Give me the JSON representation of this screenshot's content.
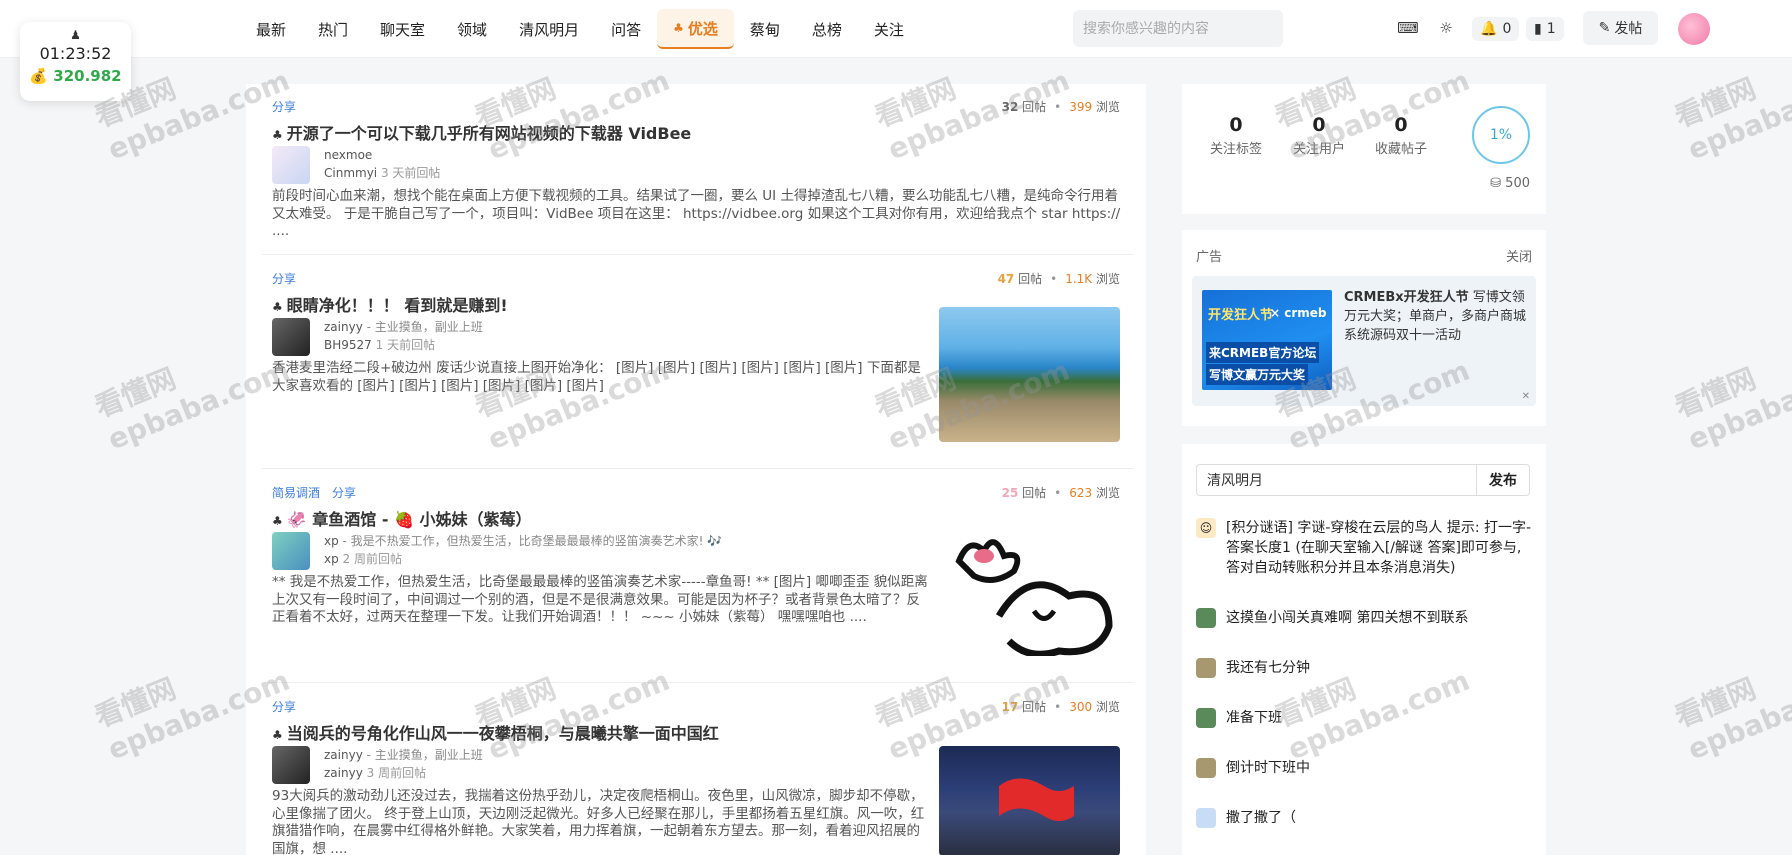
{
  "header": {
    "nav": [
      {
        "label": "最新"
      },
      {
        "label": "热门"
      },
      {
        "label": "聊天室"
      },
      {
        "label": "领域"
      },
      {
        "label": "清风明月"
      },
      {
        "label": "问答"
      },
      {
        "label": "优选",
        "active": true
      },
      {
        "label": "蔡甸"
      },
      {
        "label": "总榜"
      },
      {
        "label": "关注"
      }
    ],
    "search_placeholder": "搜索你感兴趣的内容",
    "notif_count": "0",
    "msg_count": "1",
    "post_label": "发帖"
  },
  "timer": {
    "time": "01:23:52",
    "money": "320.982"
  },
  "posts": [
    {
      "tags": [
        "分享"
      ],
      "replies": "32",
      "reply_label": "回帖",
      "views": "399",
      "view_label": "浏览",
      "reply_color": "#e67e22",
      "title": "开源了一个可以下载几乎所有网站视频的下载器 VidBee",
      "author": "nexmoe",
      "signature": "",
      "last_user": "Cinmmyi",
      "last_time": "3 天前回帖",
      "excerpt": "前段时间心血来潮，想找个能在桌面上方便下载视频的工具。结果试了一圈，要么 UI 土得掉渣乱七八糟，要么功能乱七八糟，是纯命令行用着又太难受。 于是干脆自己写了一个，项目叫：VidBee 项目在这里： https://vidbee.org 如果这个工具对你有用，欢迎给我点个 star https:// ...."
    },
    {
      "tags": [
        "分享"
      ],
      "replies": "47",
      "reply_label": "回帖",
      "views": "1.1K",
      "view_label": "浏览",
      "reply_color": "#e6a23c",
      "title": "眼睛净化！！！ 看到就是赚到!",
      "author": "zainyy",
      "signature": " - 主业摸鱼，副业上班",
      "last_user": "BH9527",
      "last_time": "1 天前回帖",
      "excerpt": "香港麦里浩经二段+破边州 废话少说直接上图开始净化： [图片] [图片] [图片] [图片] [图片] [图片] 下面都是大家喜欢看的 [图片] [图片] [图片] [图片] [图片] [图片]"
    },
    {
      "tags": [
        "简易调酒",
        "分享"
      ],
      "replies": "25",
      "reply_label": "回帖",
      "views": "623",
      "view_label": "浏览",
      "reply_color": "#f4a6b6",
      "title": "🦑 章鱼酒馆 - 🍓 小姊妹（紫莓）",
      "author": "xp",
      "signature": " - 我是不热爱工作，但热爱生活，比奇堡最最最棒的竖笛演奏艺术家! 🎶",
      "last_user": "xp",
      "last_time": "2 周前回帖",
      "excerpt": "** 我是不热爱工作，但热爱生活，比奇堡最最最棒的竖笛演奏艺术家-----章鱼哥! ** [图片] 唧唧歪歪 貌似距离上次又有一段时间了，中间调过一个别的酒，但是不是很满意效果。可能是因为杯子？或者背景色太暗了？反正看着不太好，过两天在整理一下发。让我们开始调酒！！！ ~~~ 小姊妹（紫莓） 嘿嘿嘿咱也 ...."
    },
    {
      "tags": [
        "分享"
      ],
      "replies": "17",
      "reply_label": "回帖",
      "views": "300",
      "view_label": "浏览",
      "reply_color": "#e6a23c",
      "title": "当阅兵的号角化作山风一一夜攀梧桐，与晨曦共擎一面中国红",
      "author": "zainyy",
      "signature": " - 主业摸鱼，副业上班",
      "last_user": "zainyy",
      "last_time": "3 周前回帖",
      "excerpt": "93大阅兵的激动劲儿还没过去，我揣着这份热乎劲儿，决定夜爬梧桐山。夜色里，山风微凉，脚步却不停歇，心里像揣了团火。 终于登上山顶，天边刚泛起微光。好多人已经聚在那儿，手里都扬着五星红旗。风一吹，红旗猎猎作响，在晨雾中红得格外鲜艳。大家笑着，用力挥着旗，一起朝着东方望去。那一刻，看着迎风招展的国旗，想 ...."
    }
  ],
  "profile": {
    "stats": [
      {
        "num": "0",
        "label": "关注标签"
      },
      {
        "num": "0",
        "label": "关注用户"
      },
      {
        "num": "0",
        "label": "收藏帖子"
      }
    ],
    "progress": "1%",
    "progress_value": 0.01,
    "points": "500"
  },
  "ad": {
    "label": "广告",
    "close": "关闭",
    "img_line1": "开发狂人节",
    "img_line2": "× crmeb",
    "img_line3": "来CRMEB官方论坛",
    "img_line4": "写博文赢万元大奖",
    "title": "CRMEBx开发狂人节",
    "text": " 写博文领万元大奖；单商户，多商户商城系统源码双十一活动"
  },
  "chat": {
    "input_value": "清风明月",
    "send_label": "发布",
    "messages": [
      {
        "text": "[积分谜语] 字谜-穿梭在云层的鸟人 提示: 打一字-答案长度1 (在聊天室输入[/解谜 答案]即可参与, 答对自动转账积分并且本条消息消失)"
      },
      {
        "text": "这摸鱼小闯关真难啊 第四关想不到联系"
      },
      {
        "text": "我还有七分钟"
      },
      {
        "text": "准备下班"
      },
      {
        "text": "倒计时下班中"
      },
      {
        "text": "撒了撒了（"
      }
    ]
  },
  "watermark": {
    "line1": "看懂网",
    "line2": "epbaba.com"
  },
  "colors": {
    "accent": "#e67e22",
    "link": "#3b7ddd",
    "money": "#2eaa4b"
  }
}
